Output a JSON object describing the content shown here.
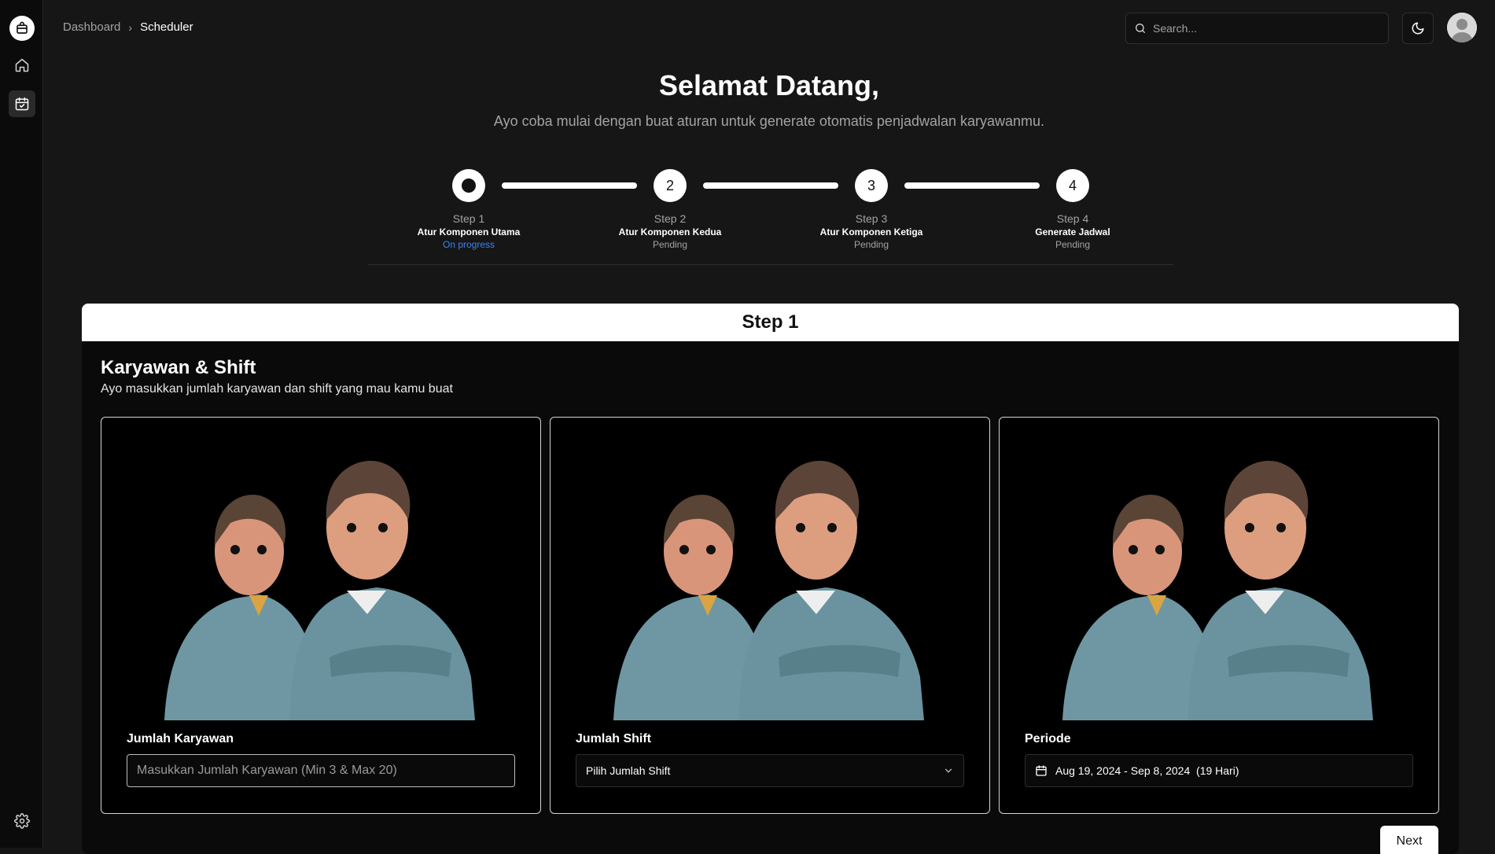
{
  "breadcrumb": {
    "root": "Dashboard",
    "current": "Scheduler"
  },
  "search": {
    "placeholder": "Search..."
  },
  "hero": {
    "title": "Selamat Datang,",
    "subtitle": "Ayo coba mulai dengan buat aturan untuk generate otomatis penjadwalan karyawanmu."
  },
  "steps": [
    {
      "number": "1",
      "label": "Step 1",
      "name": "Atur Komponen Utama",
      "status": "On progress"
    },
    {
      "number": "2",
      "label": "Step 2",
      "name": "Atur Komponen Kedua",
      "status": "Pending"
    },
    {
      "number": "3",
      "label": "Step 3",
      "name": "Atur Komponen Ketiga",
      "status": "Pending"
    },
    {
      "number": "4",
      "label": "Step 4",
      "name": "Generate Jadwal",
      "status": "Pending"
    }
  ],
  "panel": {
    "header": "Step 1",
    "title": "Karyawan & Shift",
    "subtitle": "Ayo masukkan jumlah karyawan dan shift yang mau kamu buat"
  },
  "cards": {
    "employees": {
      "label": "Jumlah Karyawan",
      "placeholder": "Masukkan Jumlah Karyawan (Min 3 & Max 20)"
    },
    "shifts": {
      "label": "Jumlah Shift",
      "value": "Pilih Jumlah Shift"
    },
    "period": {
      "label": "Periode",
      "value": "Aug 19, 2024 - Sep 8, 2024  (19 Hari)"
    }
  },
  "next_label": "Next",
  "colors": {
    "accent": "#3b82f6",
    "background": "#161616",
    "panel": "#0a0a0a",
    "shirt": "#6f97a3"
  }
}
